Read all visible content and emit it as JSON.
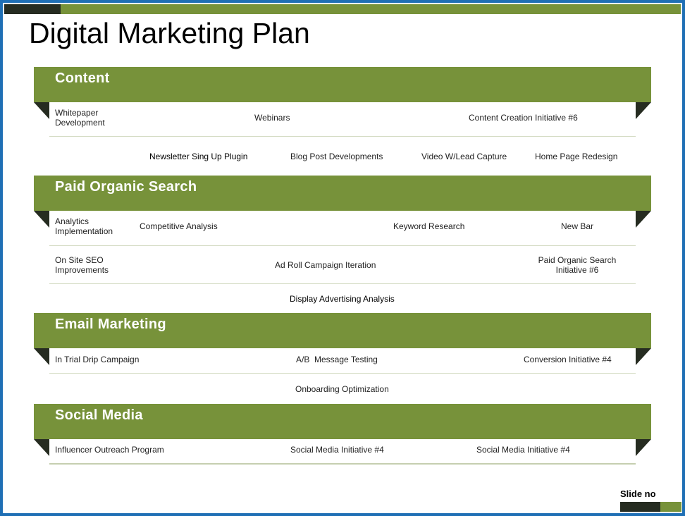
{
  "title": "Digital Marketing Plan",
  "slide_label": "Slide no",
  "sections": [
    {
      "label": "Content",
      "items": [
        "Whitepaper Development",
        "Webinars",
        "Content Creation Initiative #6",
        "Newsletter Sing Up Plugin",
        "Blog Post Developments",
        "Video W/Lead Capture",
        "Home Page Redesign"
      ]
    },
    {
      "label": "Paid Organic Search",
      "items": [
        "Analytics Implementation",
        "Competitive Analysis",
        "Keyword Research",
        "New Bar",
        "On Site SEO Improvements",
        "Ad Roll Campaign Iteration",
        "Paid Organic Search Initiative #6",
        "Display Advertising Analysis"
      ]
    },
    {
      "label": "Email Marketing",
      "items": [
        "In Trial Drip Campaign",
        "A/B  Message Testing",
        "Conversion Initiative #4",
        "Onboarding Optimization"
      ]
    },
    {
      "label": "Social Media",
      "items": [
        "Influencer Outreach Program",
        "Social Media Initiative #4",
        "Social Media Initiative #4"
      ]
    }
  ],
  "colors": {
    "accent_green": "#77923a",
    "dark_fold": "#262c21",
    "outer_border": "#1f6fb5"
  }
}
